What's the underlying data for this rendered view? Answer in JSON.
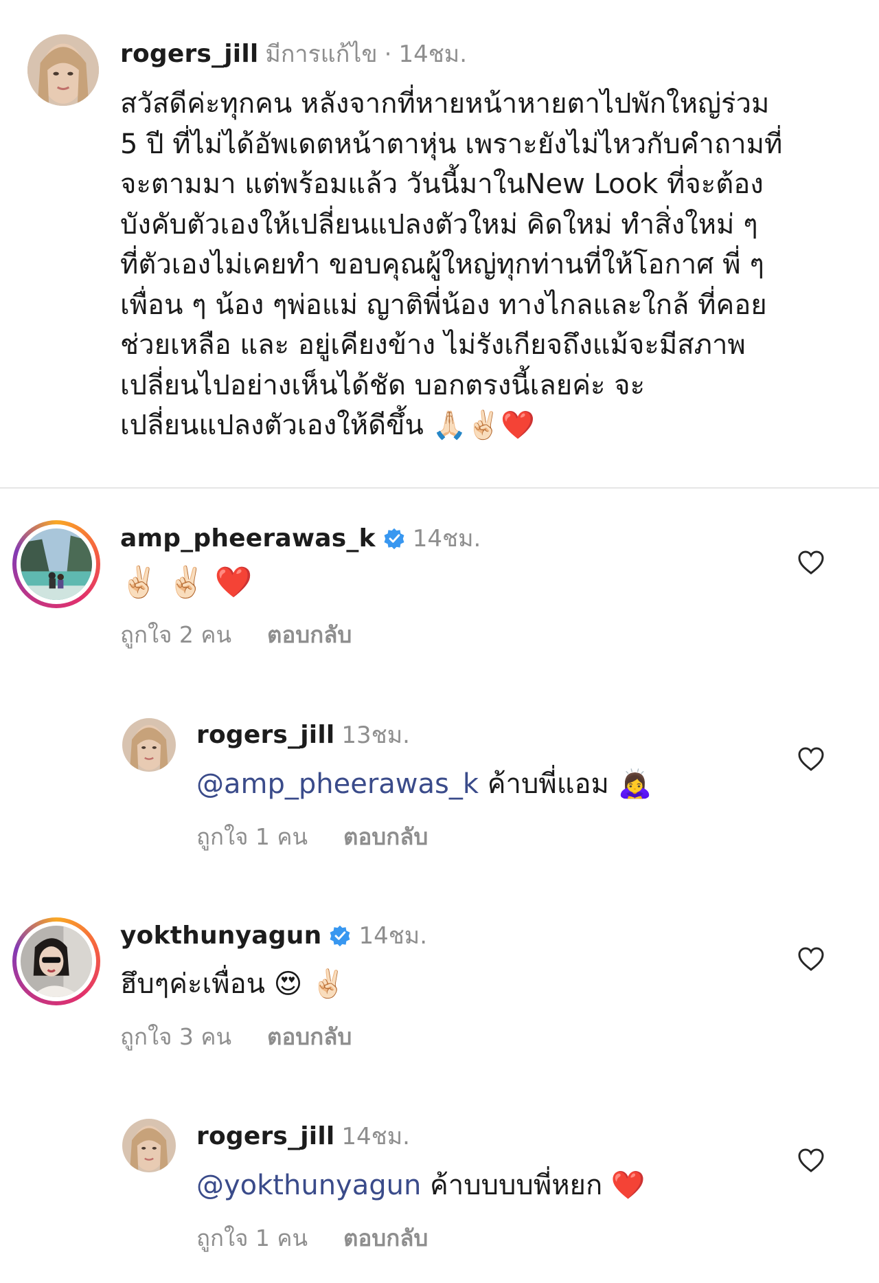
{
  "post": {
    "username": "rogers_jill",
    "edited": "มีการแก้ไข",
    "separator": "·",
    "time": "14ชม.",
    "caption": "สวัสดีค่ะทุกคน หลังจากที่หายหน้าหายตาไปพักใหญ่ร่วม\n5 ปี ที่ไม่ได้อัพเดตหน้าตาหุ่น เพราะยังไม่ไหวกับคำถามที่\nจะตามมา แต่พร้อมแล้ว วันนี้มาในNew Look ที่จะต้อง\nบังคับตัวเองให้เปลี่ยนแปลงตัวใหม่ คิดใหม่ ทำสิ่งใหม่ ๆ\nที่ตัวเองไม่เคยทำ ขอบคุณผู้ใหญ่ทุกท่านที่ให้โอกาศ พี่ ๆ\nเพื่อน ๆ น้อง ๆพ่อแม่ ญาติพี่น้อง ทางไกลและใกล้ ที่คอย\nช่วยเหลือ และ อยู่เคียงข้าง ไม่รังเกียจถึงแม้จะมีสภาพ\nเปลี่ยนไปอย่างเห็นได้ชัด บอกตรงนี้เลยค่ะ จะ\nเปลี่ยนแปลงตัวเองให้ดีขึ้น 🙏🏻✌🏻❤️"
  },
  "comments": [
    {
      "username": "amp_pheerawas_k",
      "verified": true,
      "time": "14ชม.",
      "text": "✌🏻 ✌🏻 ❤️",
      "likes": "ถูกใจ 2 คน",
      "reply": "ตอบกลับ"
    },
    {
      "username": "rogers_jill",
      "verified": false,
      "time": "13ชม.",
      "mention": "@amp_pheerawas_k",
      "text": " ค้าบพี่แอม 🙇‍♀️",
      "likes": "ถูกใจ 1 คน",
      "reply": "ตอบกลับ"
    },
    {
      "username": "yokthunyagun",
      "verified": true,
      "time": "14ชม.",
      "text": "ฮึบๆค่ะเพื่อน 😍 ✌🏻",
      "likes": "ถูกใจ 3 คน",
      "reply": "ตอบกลับ"
    },
    {
      "username": "rogers_jill",
      "verified": false,
      "time": "14ชม.",
      "mention": "@yokthunyagun",
      "text": " ค้าบบบบพี่หยก ❤️",
      "likes": "ถูกใจ 1 คน",
      "reply": "ตอบกลับ"
    }
  ],
  "icons": {
    "like": "heart-outline-icon",
    "verified": "verified-badge-icon"
  },
  "colors": {
    "verified": "#3897f0",
    "mention": "#3a4b8a",
    "meta": "#8e8e8e"
  }
}
